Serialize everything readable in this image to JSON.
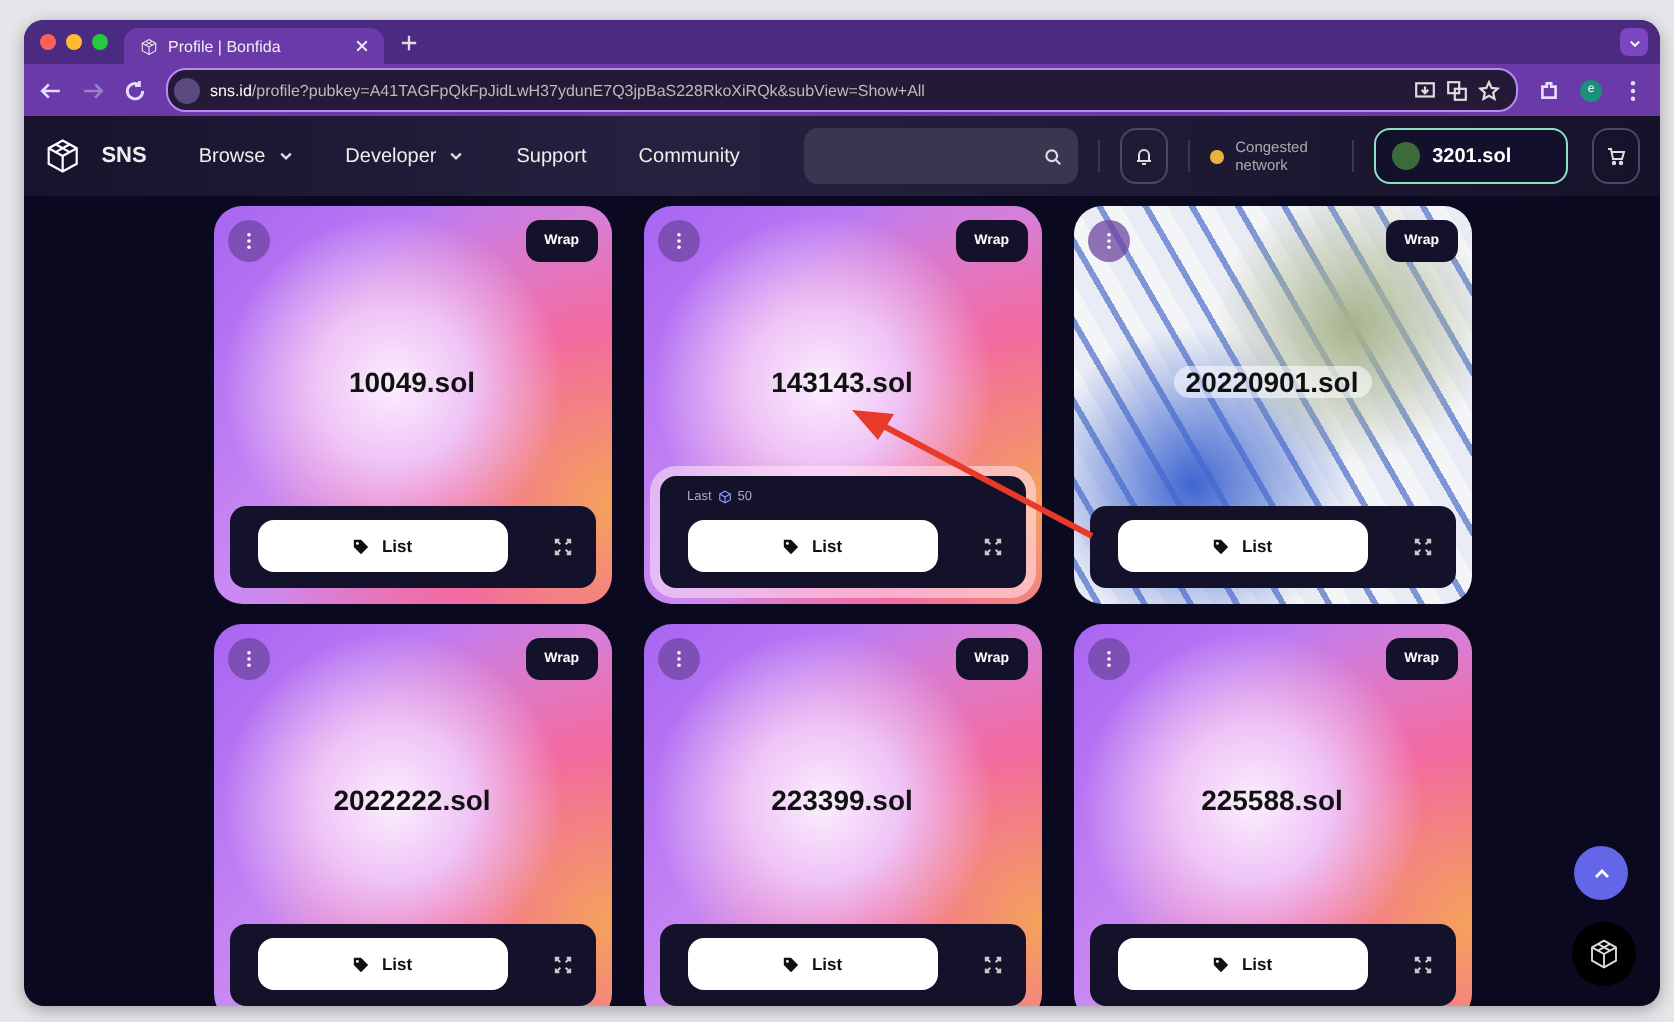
{
  "browser": {
    "tab_title": "Profile | Bonfida",
    "url_host": "sns.id",
    "url_path": "/profile?pubkey=A41TAGFpQkFpJidLwH37ydunE7Q3jpBaS228RkoXiRQk&subView=Show+All",
    "profile_initial": "e"
  },
  "nav": {
    "brand": "SNS",
    "links": [
      {
        "label": "Browse",
        "dropdown": true
      },
      {
        "label": "Developer",
        "dropdown": true
      },
      {
        "label": "Support",
        "dropdown": false
      },
      {
        "label": "Community",
        "dropdown": false
      }
    ],
    "status": "Congested network",
    "wallet": "3201.sol"
  },
  "cards": [
    {
      "name": "10049.sol",
      "kind": "gradient",
      "wrap": "Wrap",
      "action": "List"
    },
    {
      "name": "143143.sol",
      "kind": "gradient",
      "wrap": "Wrap",
      "action": "List",
      "last_label": "Last",
      "last_price": "50"
    },
    {
      "name": "20220901.sol",
      "kind": "photo",
      "wrap": "Wrap",
      "action": "List"
    },
    {
      "name": "2022222.sol",
      "kind": "gradient",
      "wrap": "Wrap",
      "action": "List"
    },
    {
      "name": "223399.sol",
      "kind": "gradient",
      "wrap": "Wrap",
      "action": "List"
    },
    {
      "name": "225588.sol",
      "kind": "gradient",
      "wrap": "Wrap",
      "action": "List"
    }
  ]
}
